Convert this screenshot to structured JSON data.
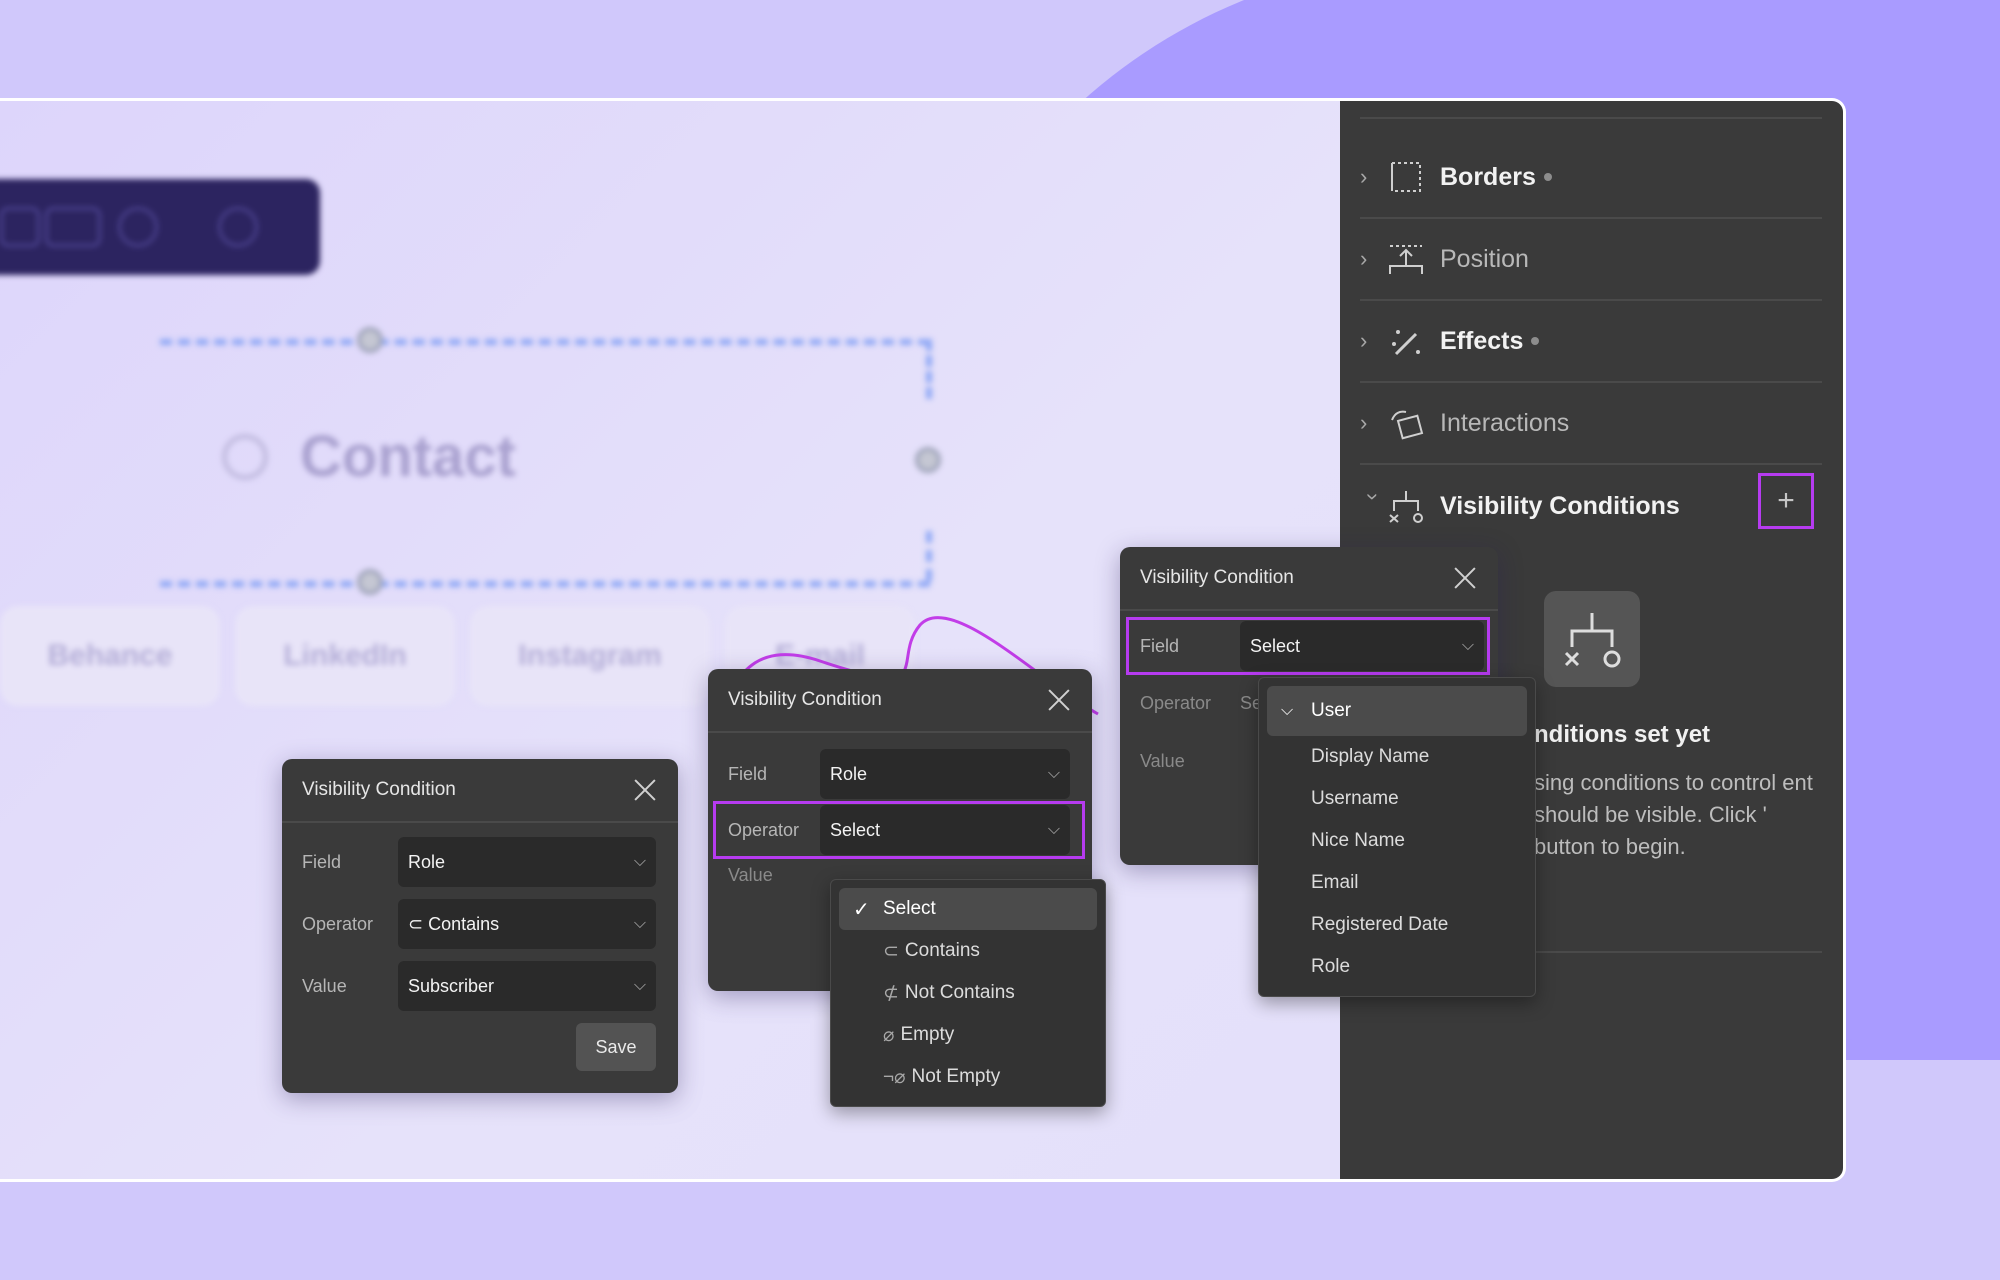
{
  "canvas": {
    "heading": "Contact",
    "social_items": [
      "Behance",
      "LinkedIn",
      "Instagram",
      "E-mail"
    ]
  },
  "panel": {
    "sections": [
      {
        "label": "Borders",
        "icon": "border-icon",
        "has_dot": true,
        "bold": true
      },
      {
        "label": "Position",
        "icon": "position-icon",
        "has_dot": false,
        "bold": false
      },
      {
        "label": "Effects",
        "icon": "effects-wand-icon",
        "has_dot": true,
        "bold": true
      },
      {
        "label": "Interactions",
        "icon": "interactions-icon",
        "has_dot": false,
        "bold": false
      },
      {
        "label": "Visibility Conditions",
        "icon": "visibility-conditions-icon",
        "has_dot": false,
        "bold": true
      }
    ],
    "add_label": "+",
    "empty_title": "nditions set yet",
    "empty_desc": "sing conditions to control ent should be visible. Click ' button to begin."
  },
  "dialog1": {
    "title": "Visibility Condition",
    "field_label": "Field",
    "field_value": "Role",
    "operator_label": "Operator",
    "operator_value": "⊂ Contains",
    "value_label": "Value",
    "value_value": "Subscriber",
    "save_label": "Save"
  },
  "dialog2": {
    "title": "Visibility Condition",
    "field_label": "Field",
    "field_value": "Role",
    "operator_label": "Operator",
    "operator_value": "Select",
    "value_label": "Value",
    "operator_options": [
      {
        "sym": "",
        "label": "Select",
        "selected": true
      },
      {
        "sym": "⊂",
        "label": "Contains",
        "selected": false
      },
      {
        "sym": "⊄",
        "label": "Not Contains",
        "selected": false
      },
      {
        "sym": "⌀",
        "label": "Empty",
        "selected": false
      },
      {
        "sym": "¬⌀",
        "label": "Not Empty",
        "selected": false
      }
    ]
  },
  "dialog3": {
    "title": "Visibility Condition",
    "field_label": "Field",
    "field_value": "Select",
    "operator_label": "Operator",
    "operator_value": "Se",
    "value_label": "Value",
    "field_group": "User",
    "field_options": [
      "Display Name",
      "Username",
      "Nice Name",
      "Email",
      "Registered Date",
      "Role"
    ]
  },
  "colors": {
    "background": "#d0c8fb",
    "blob": "#a99bff",
    "panel": "#3a3a3a",
    "highlight": "#b63bf0"
  }
}
